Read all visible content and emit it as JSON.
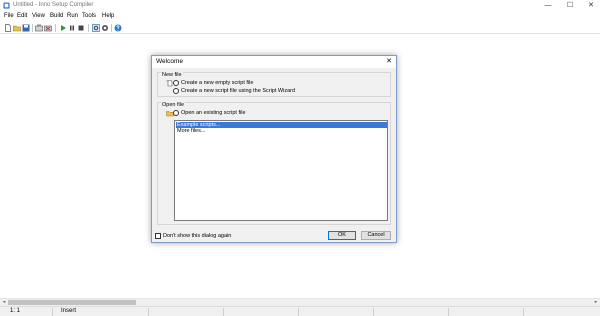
{
  "window": {
    "title": "Untitled - Inno Setup Compiler",
    "minimize_glyph": "—",
    "maximize_glyph": "☐",
    "close_glyph": "✕"
  },
  "menu": [
    "File",
    "Edit",
    "View",
    "Build",
    "Run",
    "Tools",
    "Help"
  ],
  "toolbar": {
    "icons": [
      "new-icon",
      "open-icon",
      "save-icon",
      "compile-icon",
      "stop-compile-icon",
      "run-icon",
      "pause-icon",
      "terminate-icon",
      "target-setup-icon",
      "target-uninstall-icon",
      "help-icon"
    ]
  },
  "statusbar": {
    "position": "1:   1",
    "mode": "Insert"
  },
  "hscroll": {
    "left_glyph": "◂",
    "right_glyph": "▸"
  },
  "dialog": {
    "title": "Welcome",
    "close_glyph": "✕",
    "new_file": {
      "label": "New file",
      "option_empty": "Create a new empty script file",
      "option_wizard": "Create a new script file using the Script Wizard"
    },
    "open_file": {
      "label": "Open file",
      "option_existing": "Open an existing script file",
      "items": [
        "Example scripts...",
        "More files..."
      ],
      "selected_index": 0
    },
    "dont_show": "Don't show this dialog again",
    "ok": "OK",
    "cancel": "Cancel"
  },
  "colors": {
    "selection": "#3b78d8",
    "dialog_border": "#7a9cc6",
    "ok_border": "#0078d7"
  }
}
